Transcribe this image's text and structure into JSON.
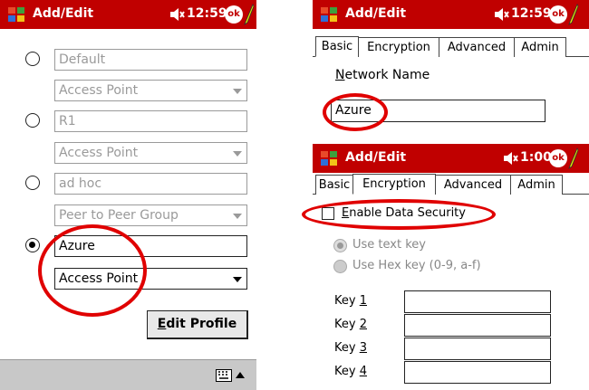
{
  "left": {
    "title": "Add/Edit",
    "time": "12:59",
    "ok": "ok",
    "profiles": [
      {
        "name": "Default",
        "type": "Access Point",
        "selected": false
      },
      {
        "name": "R1",
        "type": "Access Point",
        "selected": false
      },
      {
        "name": "ad hoc",
        "type": "Peer to Peer Group",
        "selected": false
      },
      {
        "name": "Azure",
        "type": "Access Point",
        "selected": true
      }
    ],
    "edit_profile_hotkey": "E",
    "edit_profile_label": "dit Profile"
  },
  "top_right": {
    "title": "Add/Edit",
    "time": "12:59",
    "ok": "ok",
    "tabs": [
      "Basic",
      "Encryption",
      "Advanced",
      "Admin"
    ],
    "network_name_hotkey": "N",
    "network_name_label": "etwork Name",
    "network_name_value": "Azure"
  },
  "bottom_right": {
    "title": "Add/Edit",
    "time": "1:00",
    "ok": "ok",
    "tabs": [
      "Basic",
      "Encryption",
      "Advanced",
      "Admin"
    ],
    "enable_hotkey": "E",
    "enable_label": "nable Data Security",
    "use_text_key": "Use text key",
    "use_hex_key": "Use Hex key (0-9, a-f)",
    "keys": [
      {
        "prefix": "Key ",
        "num": "1"
      },
      {
        "prefix": "Key ",
        "num": "2"
      },
      {
        "prefix": "Key ",
        "num": "3"
      },
      {
        "prefix": "Key ",
        "num": "4"
      }
    ]
  },
  "colors": {
    "titlebar": "#c00000",
    "annotation_circle": "#e00000",
    "taskbar": "#c8c8c8"
  }
}
